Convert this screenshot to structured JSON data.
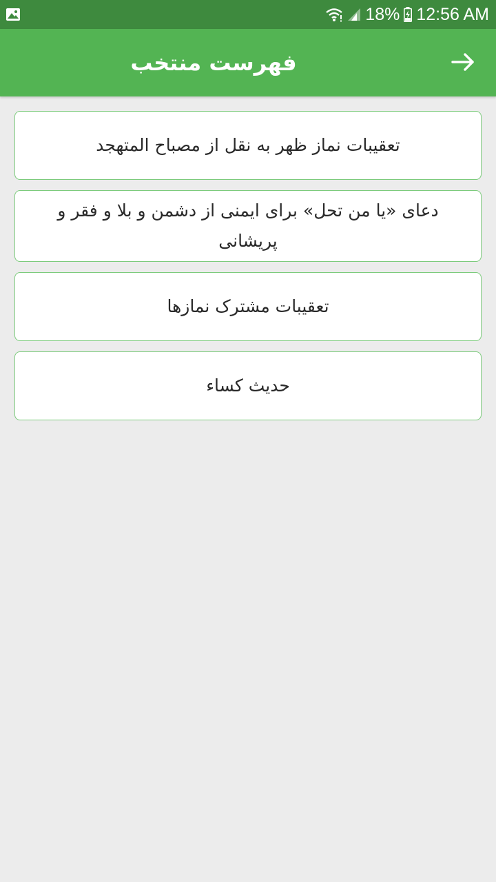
{
  "status_bar": {
    "time": "12:56 AM",
    "battery_percent": "18%",
    "icons": [
      "image-notification-icon",
      "wifi-icon",
      "signal-icon",
      "battery-charging-icon"
    ]
  },
  "app_bar": {
    "title": "فهرست منتخب",
    "back_icon": "arrow-right-icon"
  },
  "items": [
    {
      "label": "تعقیبات نماز ظهر به نقل از مصباح المتهجد"
    },
    {
      "label": "دعای «یا من تحل» برای ایمنی از دشمن و بلا و فقر و پریشانی"
    },
    {
      "label": "تعقیبات مشترک نمازها"
    },
    {
      "label": "حدیث کساء"
    }
  ],
  "colors": {
    "status_bar": "#3e8a3e",
    "app_bar": "#53b453",
    "card_border": "#7ccb7c",
    "background": "#ececec"
  }
}
